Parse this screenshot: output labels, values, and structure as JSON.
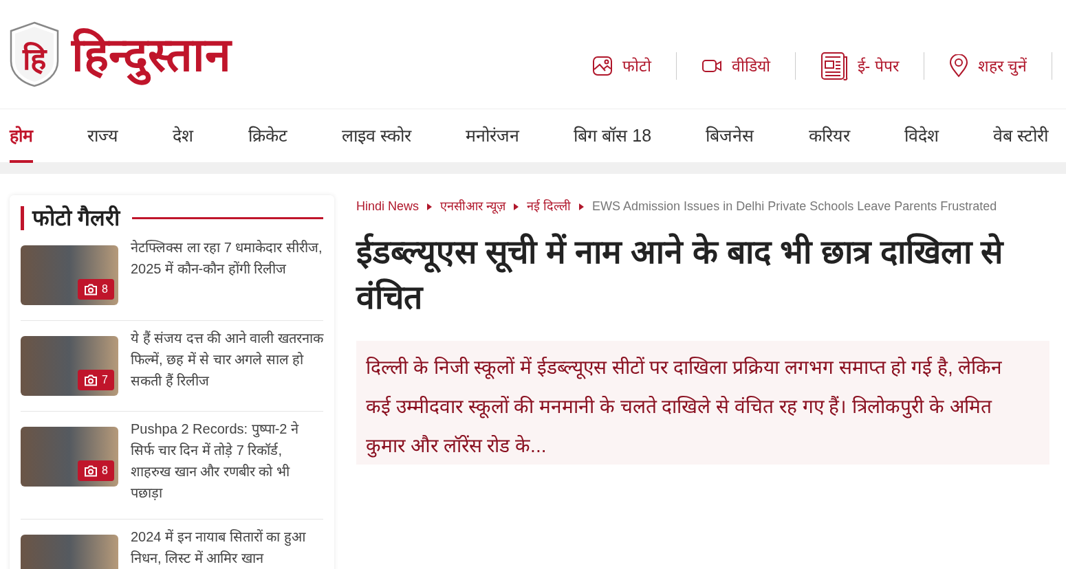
{
  "logo": {
    "emblem": "हि",
    "name": "हिन्दुस्तान"
  },
  "header_links": [
    {
      "kind": "photo",
      "label": "फोटो"
    },
    {
      "kind": "video",
      "label": "वीडियो"
    },
    {
      "kind": "epaper",
      "label": "ई- पेपर"
    },
    {
      "kind": "city",
      "label": "शहर चुनें"
    }
  ],
  "nav": [
    {
      "label": "होम",
      "selected": true
    },
    {
      "label": "राज्य",
      "selected": false
    },
    {
      "label": "देश",
      "selected": false
    },
    {
      "label": "क्रिकेट",
      "selected": false
    },
    {
      "label": "लाइव स्कोर",
      "selected": false
    },
    {
      "label": "मनोरंजन",
      "selected": false
    },
    {
      "label": "बिग बॉस 18",
      "selected": false
    },
    {
      "label": "बिजनेस",
      "selected": false
    },
    {
      "label": "करियर",
      "selected": false
    },
    {
      "label": "विदेश",
      "selected": false
    },
    {
      "label": "वेब स्टोरी",
      "selected": false
    }
  ],
  "photo_gallery": {
    "title": "फोटो गैलरी",
    "items": [
      {
        "title": "नेटफ्लिक्स ला रहा 7 धमाकेदार सीरीज, 2025 में कौन-कौन होंगी रिलीज",
        "count": "8"
      },
      {
        "title": "ये हैं संजय दत्त की आने वाली खतरनाक फिल्में, छह में से चार अगले साल हो सकती हैं रिलीज",
        "count": "7"
      },
      {
        "title": "Pushpa 2 Records: पुष्पा-2 ने सिर्फ चार दिन में तोड़े 7 रिकॉर्ड, शाहरुख खान और रणबीर को भी पछाड़ा",
        "count": "8"
      },
      {
        "title": "2024 में इन नायाब सितारों का हुआ निधन, लिस्ट में आमिर खान"
      }
    ]
  },
  "breadcrumb": [
    {
      "label": "Hindi News",
      "kind": "link"
    },
    {
      "label": "एनसीआर न्यूज़",
      "kind": "link"
    },
    {
      "label": "नई दिल्ली",
      "kind": "link"
    },
    {
      "label": "EWS Admission Issues in Delhi Private Schools Leave Parents Frustrated",
      "kind": "current"
    }
  ],
  "article": {
    "headline": "ईडब्ल्यूएस सूची में नाम आने के बाद भी छात्र दाखिला से वंचित",
    "summary": "दिल्ली के निजी स्कूलों में ईडब्ल्यूएस सीटों पर दाखिला प्रक्रिया लगभग समाप्त हो गई है, लेकिन कई उम्मीदवार स्कूलों की मनमानी के चलते दाखिले से वंचित रह गए हैं। त्रिलोकपुरी के अमित कुमार और लॉरेंस रोड के..."
  }
}
